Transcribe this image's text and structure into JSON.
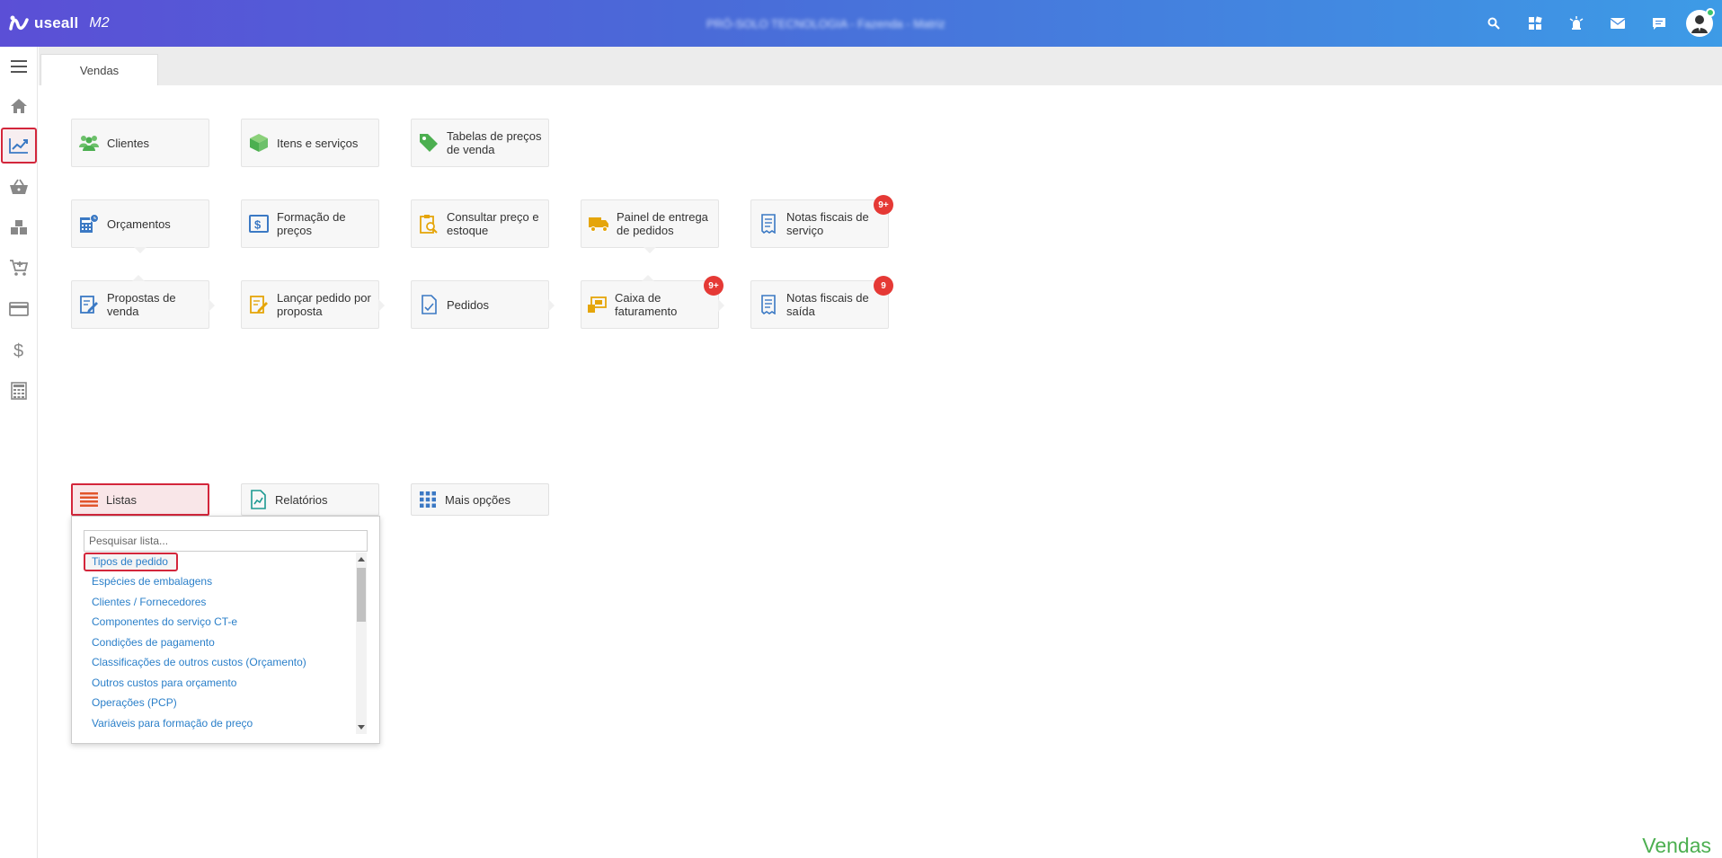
{
  "header": {
    "brand": "useall",
    "version": "M2",
    "company": "PRÓ-SOLO TECNOLOGIA - Fazenda - Matriz",
    "icons": [
      "search-icon",
      "apps-icon",
      "alarm-icon",
      "mail-icon",
      "chat-icon",
      "user-avatar"
    ]
  },
  "sidebar": {
    "items": [
      "menu-icon",
      "home-icon",
      "sales-chart-icon",
      "basket-icon",
      "boxes-icon",
      "cart-icon",
      "card-icon",
      "dollar-icon",
      "calculator-icon"
    ],
    "active": "sales-chart-icon"
  },
  "tabs": [
    {
      "label": "Vendas"
    }
  ],
  "cards": {
    "clientes": {
      "label": "Clientes"
    },
    "itens": {
      "label": "Itens e serviços"
    },
    "tabelas": {
      "label": "Tabelas de preços de venda"
    },
    "orcamentos": {
      "label": "Orçamentos"
    },
    "formacao": {
      "label": "Formação de preços"
    },
    "consultar": {
      "label": "Consultar preço e estoque"
    },
    "painel": {
      "label": "Painel de entrega de pedidos"
    },
    "nfservico": {
      "label": "Notas fiscais de serviço",
      "badge": "9+"
    },
    "propostas": {
      "label": "Propostas de venda"
    },
    "lancar": {
      "label": "Lançar pedido por proposta"
    },
    "pedidos": {
      "label": "Pedidos"
    },
    "caixa": {
      "label": "Caixa de faturamento",
      "badge": "9+"
    },
    "nfsaida": {
      "label": "Notas fiscais de saída",
      "badge": "9"
    }
  },
  "actions": {
    "listas": "Listas",
    "relatorios": "Relatórios",
    "mais": "Mais opções"
  },
  "dropdown": {
    "placeholder": "Pesquisar lista...",
    "items": [
      "Tipos de pedido",
      "Espécies de embalagens",
      "Clientes / Fornecedores",
      "Componentes do serviço CT-e",
      "Condições de pagamento",
      "Classificações de outros custos (Orçamento)",
      "Outros custos para orçamento",
      "Operações (PCP)",
      "Variáveis para formação de preço"
    ]
  },
  "footer": {
    "title": "Vendas"
  },
  "colors": {
    "accent": "#d3263b",
    "link": "#2a7fc9",
    "badge": "#e53935",
    "footer": "#4caf50"
  }
}
